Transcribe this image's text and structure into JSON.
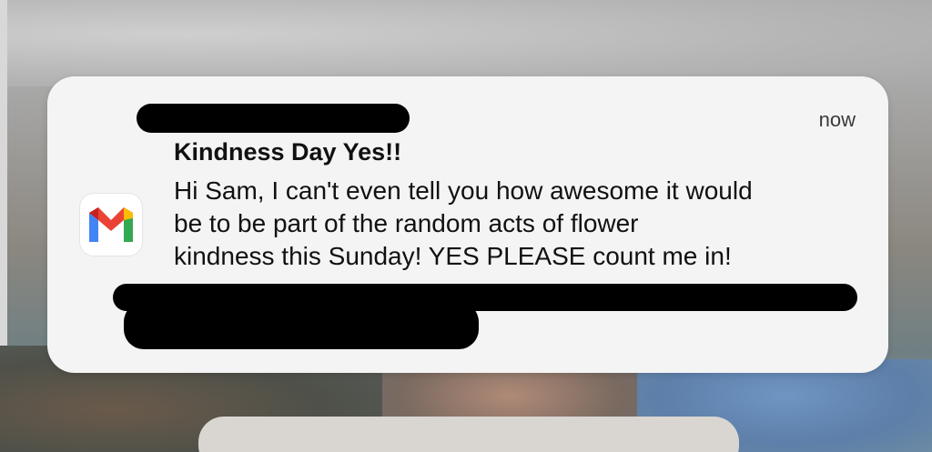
{
  "notification": {
    "app_icon": "gmail-icon",
    "time": "now",
    "title": "Kindness Day Yes!!",
    "body_lines": [
      "Hi Sam, I can't even tell you how awesome it would",
      "be to be part of the random acts of flower",
      "kindness this Sunday! YES PLEASE count me in!"
    ]
  },
  "colors": {
    "card_background": "#f4f4f4",
    "gmail_red": "#ea4335",
    "gmail_blue": "#4285f4",
    "gmail_green": "#34a853",
    "gmail_yellow": "#fbbc04",
    "redaction": "#000000"
  }
}
